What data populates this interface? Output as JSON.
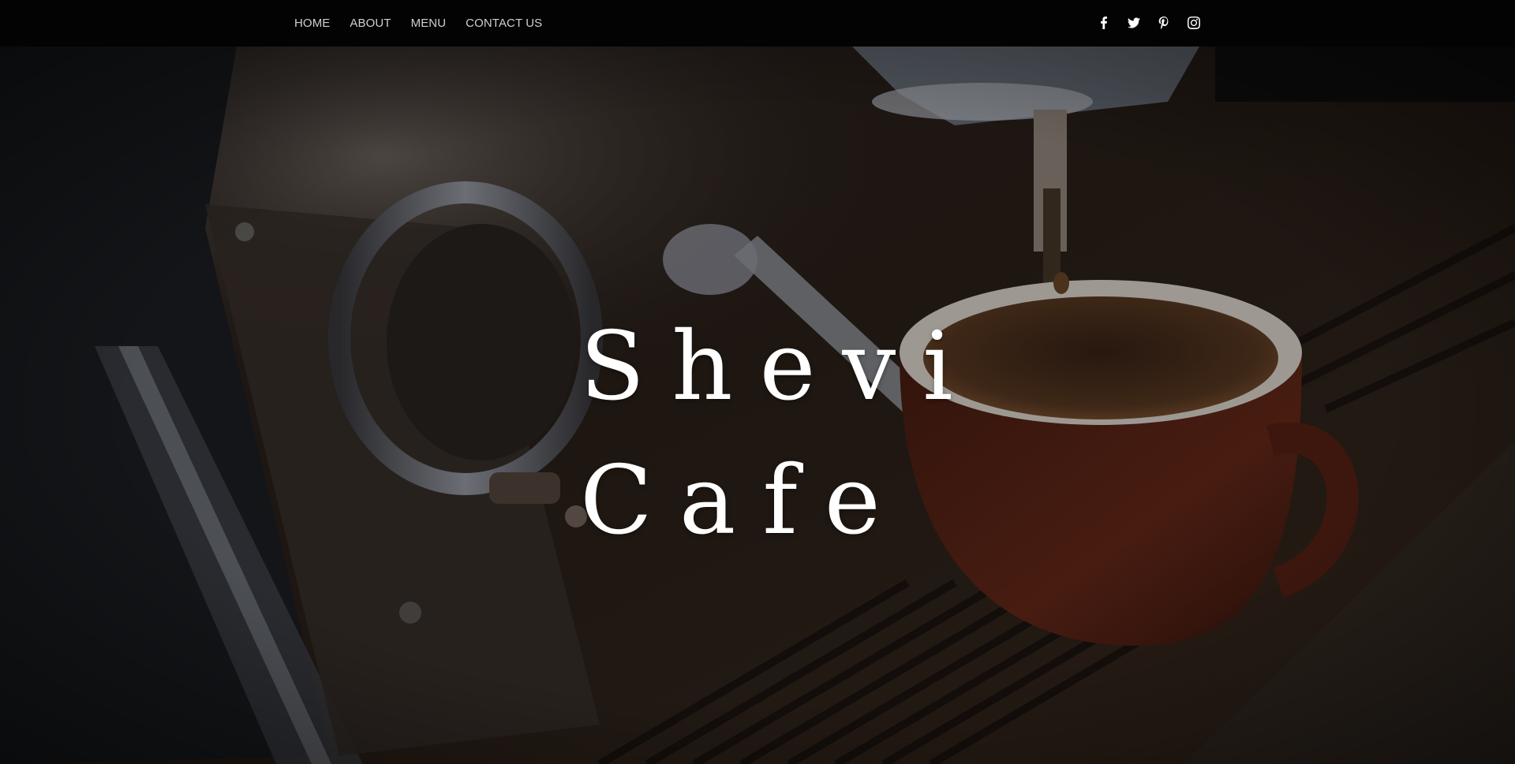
{
  "nav": {
    "items": [
      {
        "label": "HOME"
      },
      {
        "label": "ABOUT"
      },
      {
        "label": "MENU"
      },
      {
        "label": "CONTACT US"
      }
    ]
  },
  "social": {
    "icons": [
      "facebook-icon",
      "twitter-icon",
      "pinterest-icon",
      "instagram-icon"
    ]
  },
  "hero": {
    "title_line1": "Shevi",
    "title_line2": "Cafe",
    "background": "espresso machine pouring coffee into a brown cup"
  },
  "colors": {
    "topbar": "#030303",
    "nav_text": "#cfcfcf",
    "title": "#ffffff",
    "cup": "#6a2a1a"
  }
}
